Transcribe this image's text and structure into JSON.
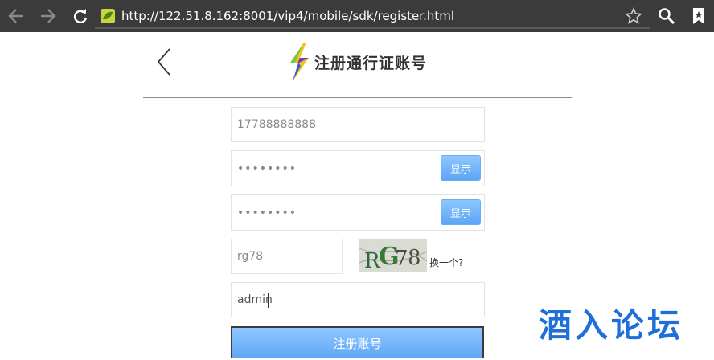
{
  "browser": {
    "url": "http://122.51.8.162:8001/vip4/mobile/sdk/register.html",
    "icons": [
      "back-icon",
      "forward-icon",
      "reload-icon",
      "site-favicon-icon",
      "star-icon",
      "search-icon",
      "bookmark-icon"
    ]
  },
  "header": {
    "title": "注册通行证账号"
  },
  "form": {
    "phone_value": "17788888888",
    "password_value": "••••••••",
    "password_show_label": "显示",
    "confirm_value": "••••••••",
    "confirm_show_label": "显示",
    "captcha_value": "rg78",
    "captcha_image_text": "RG78",
    "captcha_refresh_label": "换一个?",
    "username_value": "admin",
    "submit_label": "注册账号"
  },
  "watermark": "酒入论坛",
  "colors": {
    "toolbar": "#3b3b3b",
    "button_blue": "#5aa6f5",
    "watermark_blue": "#1f6fd8"
  }
}
